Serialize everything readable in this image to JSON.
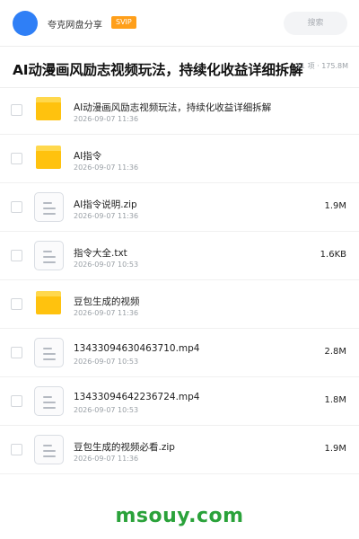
{
  "header": {
    "brand": "夸克网盘分享",
    "badge": "SVIP",
    "search_placeholder": "搜索",
    "colors": {
      "avatar": "#2f7ff6",
      "badge": "#ff9f1a"
    }
  },
  "title": {
    "text": "AI动漫画风励志视频玩法，持续化收益详细拆解",
    "meta": "11 项 · 175.8M"
  },
  "files": [
    {
      "type": "folder",
      "icon": "folder-icon",
      "name": "AI动漫画风励志视频玩法，持续化收益详细拆解",
      "date": "2026-09-07 11:36",
      "size": ""
    },
    {
      "type": "folder",
      "icon": "folder-icon",
      "name": "AI指令",
      "date": "2026-09-07 11:36",
      "size": ""
    },
    {
      "type": "file",
      "icon": "document-icon",
      "name": "AI指令说明.zip",
      "date": "2026-09-07 11:36",
      "size": "1.9M"
    },
    {
      "type": "file",
      "icon": "document-icon",
      "name": "指令大全.txt",
      "date": "2026-09-07 10:53",
      "size": "1.6KB"
    },
    {
      "type": "folder",
      "icon": "folder-icon",
      "name": "豆包生成的视频",
      "date": "2026-09-07 11:36",
      "size": ""
    },
    {
      "type": "file",
      "icon": "document-icon",
      "name": "13433094630463710.mp4",
      "date": "2026-09-07 10:53",
      "size": "2.8M"
    },
    {
      "type": "file",
      "icon": "document-icon",
      "name": "13433094642236724.mp4",
      "date": "2026-09-07 10:53",
      "size": "1.8M"
    },
    {
      "type": "file",
      "icon": "document-icon",
      "name": "豆包生成的视频必看.zip",
      "date": "2026-09-07 11:36",
      "size": "1.9M"
    }
  ],
  "watermark": {
    "text": "msouy.com",
    "color": "#2aa23a"
  }
}
